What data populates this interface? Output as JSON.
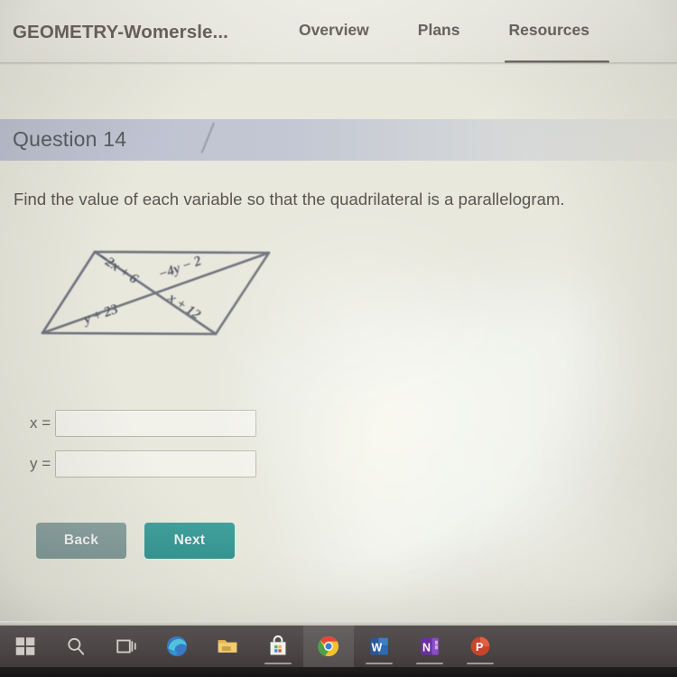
{
  "appbar": {
    "title": "GEOMETRY-Womersle...",
    "tabs": [
      {
        "label": "Overview",
        "active": false
      },
      {
        "label": "Plans",
        "active": false
      },
      {
        "label": "Resources",
        "active": true
      }
    ]
  },
  "question": {
    "header": "Question 14",
    "prompt": "Find the value of each variable so that the quadrilateral is a parallelogram."
  },
  "figure": {
    "shape": "parallelogram-with-diagonals",
    "labels": {
      "upper_left_segment": "−2x + 6",
      "upper_right_segment": "−4y − 2",
      "lower_left_segment": "y + 23",
      "lower_right_segment": "x + 12"
    }
  },
  "answers": {
    "x_label": "x =",
    "x_value": "",
    "y_label": "y =",
    "y_value": ""
  },
  "buttons": {
    "back": "Back",
    "next": "Next"
  },
  "taskbar": {
    "items": [
      {
        "name": "start",
        "label": "Start"
      },
      {
        "name": "search",
        "label": "Search"
      },
      {
        "name": "task-view",
        "label": "Task View"
      },
      {
        "name": "edge",
        "label": "Microsoft Edge"
      },
      {
        "name": "file-explorer",
        "label": "File Explorer"
      },
      {
        "name": "microsoft-store",
        "label": "Microsoft Store"
      },
      {
        "name": "chrome",
        "label": "Google Chrome"
      },
      {
        "name": "word",
        "label": "Word"
      },
      {
        "name": "onenote",
        "label": "OneNote"
      },
      {
        "name": "powerpoint",
        "label": "PowerPoint"
      }
    ]
  },
  "colors": {
    "page_bg": "#e8e8dd",
    "band": "#b4bace",
    "text": "#595450",
    "next_button": "#41a09c",
    "back_button": "#8ba2a0",
    "taskbar": "#4c4646"
  }
}
